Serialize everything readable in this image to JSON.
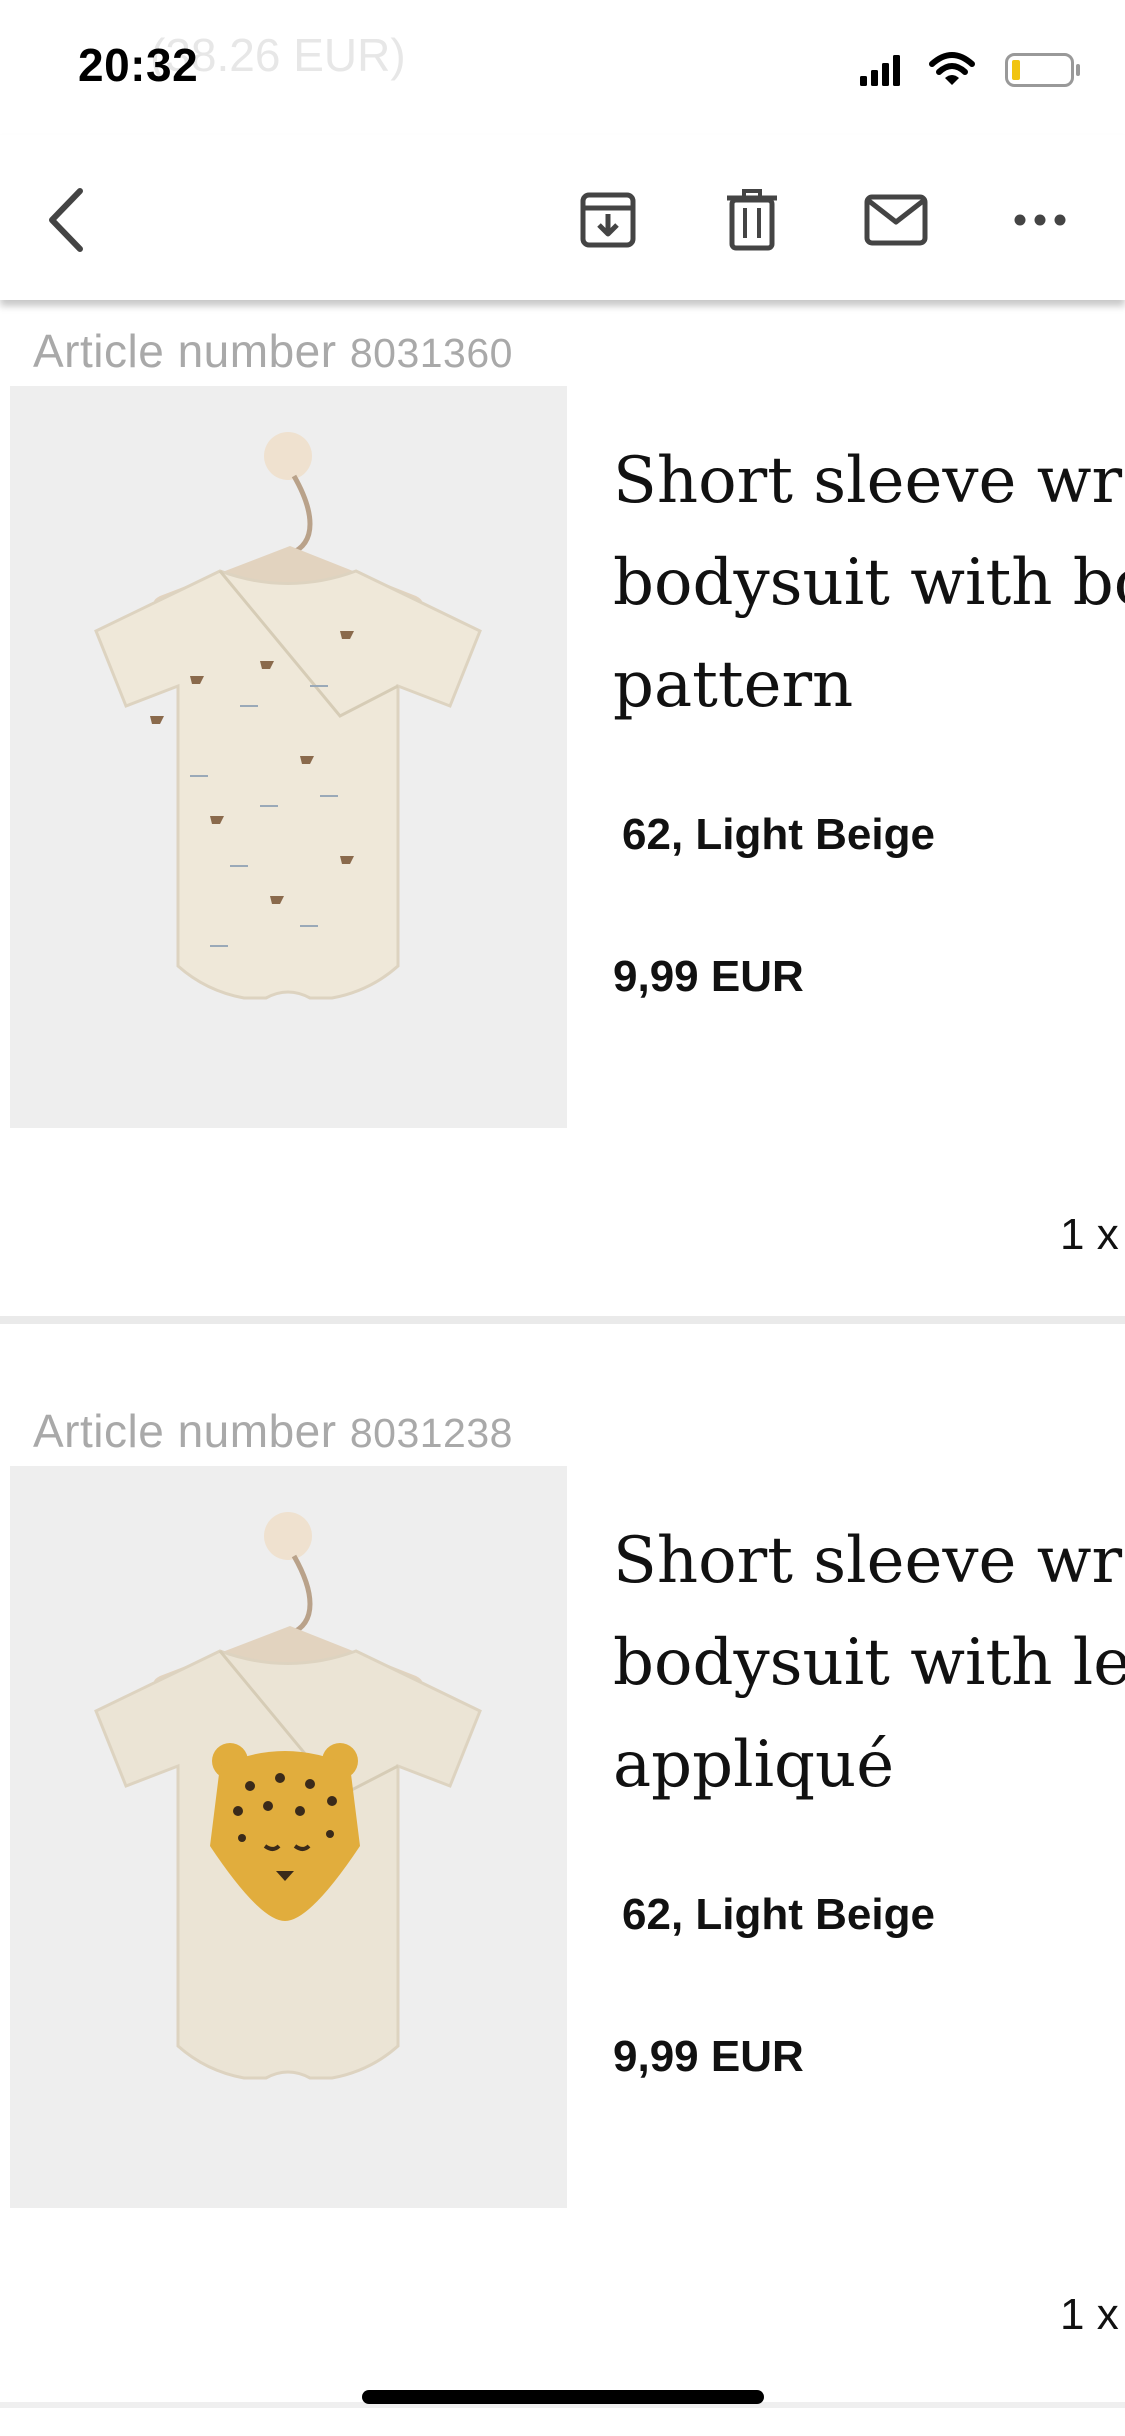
{
  "status_bar": {
    "time": "20:32",
    "ghost_text": "(38.26 EUR)"
  },
  "toolbar": {
    "back": "back",
    "archive": "archive",
    "delete": "delete",
    "mail": "mark unread",
    "more": "more"
  },
  "products": [
    {
      "article_label": "Article number",
      "article_number": "8031360",
      "title_lines": [
        "Short sleeve wra",
        "bodysuit with bo",
        "pattern"
      ],
      "variant": "62, Light Beige",
      "price": "9,99 EUR",
      "quantity": "1 x",
      "image": "bodysuit-boat-pattern-image"
    },
    {
      "article_label": "Article number",
      "article_number": "8031238",
      "title_lines": [
        "Short sleeve wra",
        "bodysuit with leo",
        "appliqué"
      ],
      "variant": "62, Light Beige",
      "price": "9,99 EUR",
      "quantity": "1 x",
      "image": "bodysuit-leopard-image"
    }
  ],
  "colors": {
    "divider": "#eaeaea",
    "muted_text": "#a9a9a9",
    "image_bg": "#eeeeee"
  }
}
